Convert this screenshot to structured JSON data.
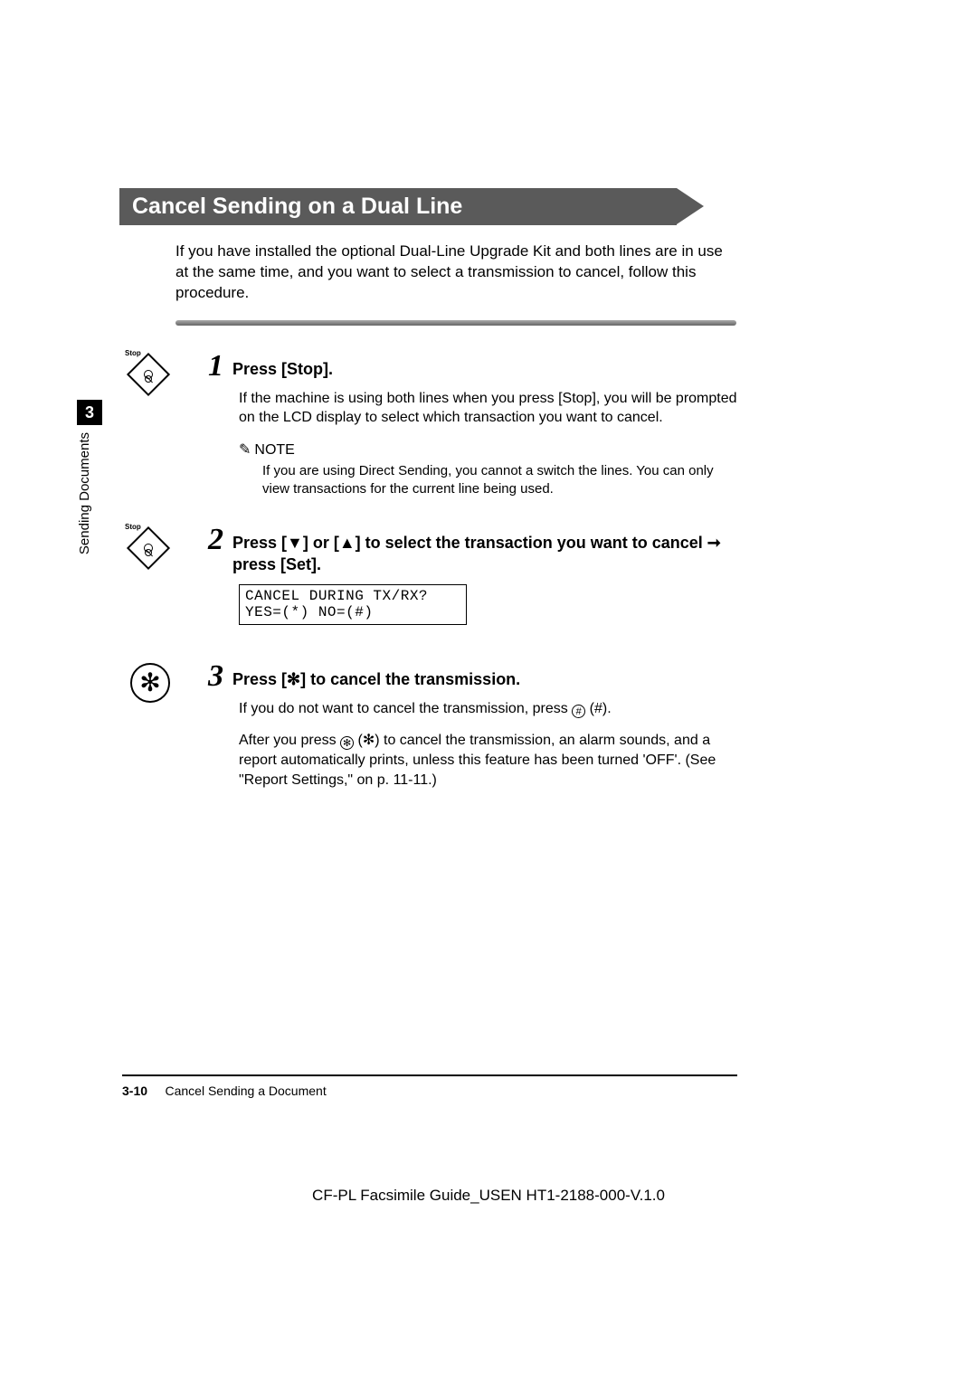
{
  "section_header": "Cancel Sending on a Dual Line",
  "intro": "If you have installed the optional Dual-Line Upgrade Kit and both lines are in use at the same time, and you want to select a transmission to cancel, follow this procedure.",
  "chapter": {
    "number": "3",
    "label": "Sending Documents"
  },
  "steps": {
    "s1": {
      "num": "1",
      "icon_label": "Stop",
      "heading": "Press [Stop].",
      "body": "If the machine is using both lines when you press [Stop], you will be prompted on the LCD display to select which transaction you want to cancel.",
      "note_label": "NOTE",
      "note_body": "If you are using Direct Sending, you cannot a switch the lines. You can only view transactions for the current line being used."
    },
    "s2": {
      "num": "2",
      "icon_label": "Stop",
      "heading_pre": "Press [▼] or [▲] to select the transaction you want to cancel ",
      "heading_arrow": "➞",
      "heading_post": " press [Set].",
      "lcd_line1": "CANCEL DURING TX/RX?",
      "lcd_line2": "YES=(*)    NO=(#)"
    },
    "s3": {
      "num": "3",
      "heading": "Press [✻] to cancel the transmission.",
      "body1_pre": "If you do not want to cancel the transmission, press ",
      "body1_sym": "#",
      "body1_post": " (#).",
      "body2_pre": "After you press ",
      "body2_sym": "✻",
      "body2_mid": " (✻) to cancel the transmission, an alarm sounds, and a report automatically prints, unless this feature has been turned 'OFF'. (See \"Report Settings,\" on p. 11-11.)"
    }
  },
  "footer": {
    "page": "3-10",
    "title": "Cancel Sending a Document"
  },
  "doc_id": "CF-PL Facsimile Guide_USEN HT1-2188-000-V.1.0"
}
